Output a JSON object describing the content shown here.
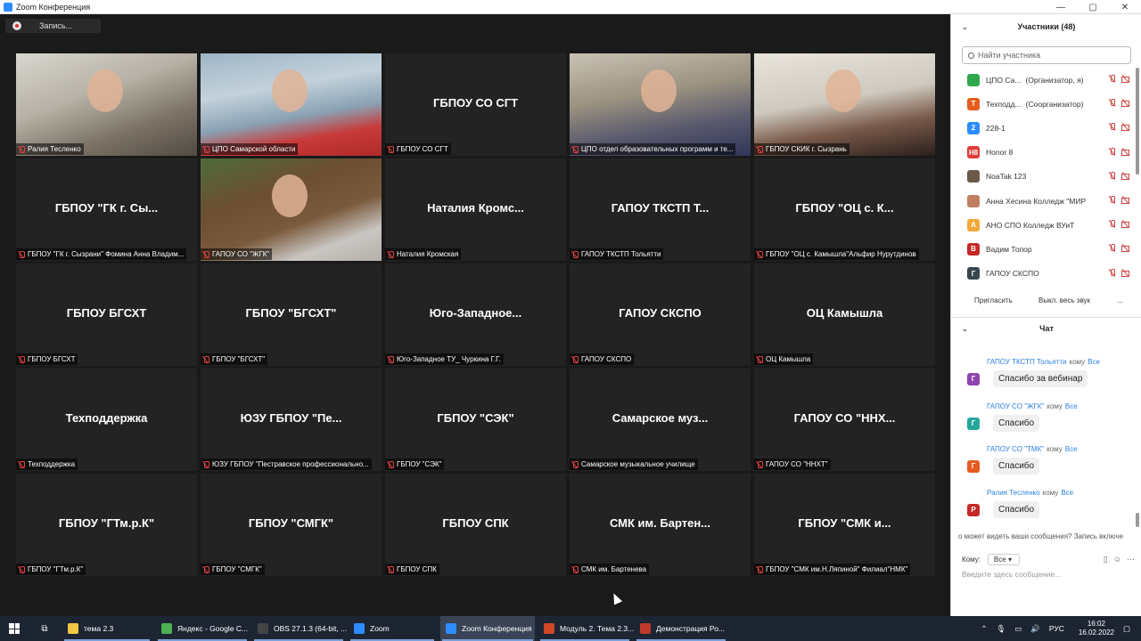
{
  "window": {
    "title": "Zoom Конференция"
  },
  "recording": {
    "label": "Запись..."
  },
  "tiles": [
    {
      "caption": "Ралия Тесленко",
      "center": "",
      "video": "v1"
    },
    {
      "caption": "ЦПО Самарской области",
      "center": "",
      "video": "v2",
      "active": true
    },
    {
      "caption": "ГБПОУ СО СГТ",
      "center": "ГБПОУ СО СГТ"
    },
    {
      "caption": "ЦПО отдел образовательных программ и те...",
      "center": "",
      "video": "v4"
    },
    {
      "caption": "ГБПОУ СКИК г. Сызрань",
      "center": "",
      "video": "v5"
    },
    {
      "caption": "ГБПОУ \"ГК г. Сызрани\" Фомина Анна Владим...",
      "center": "ГБПОУ \"ГК г. Сы..."
    },
    {
      "caption": "ГАПОУ СО \"ЖГК\"",
      "center": "",
      "video": "v7"
    },
    {
      "caption": "Наталия Кромская",
      "center": "Наталия Кромс..."
    },
    {
      "caption": "ГАПОУ ТКСТП Тольятти",
      "center": "ГАПОУ ТКСТП Т..."
    },
    {
      "caption": "ГБПОУ \"ОЦ с. Камышла\"Альфир Нурутдинов",
      "center": "ГБПОУ \"ОЦ с. К..."
    },
    {
      "caption": "ГБПОУ БГСХТ",
      "center": "ГБПОУ БГСХТ"
    },
    {
      "caption": "ГБПОУ \"БГСХТ\"",
      "center": "ГБПОУ \"БГСХТ\""
    },
    {
      "caption": "Юго-Западное ТУ_ Чуркина Г.Г.",
      "center": "Юго-Западное..."
    },
    {
      "caption": "ГАПОУ СКСПО",
      "center": "ГАПОУ СКСПО"
    },
    {
      "caption": "ОЦ Камышла",
      "center": "ОЦ Камышла"
    },
    {
      "caption": "Техподдержка",
      "center": "Техподдержка"
    },
    {
      "caption": "ЮЗУ ГБПОУ \"Пестравское профессионально...",
      "center": "ЮЗУ ГБПОУ \"Пе..."
    },
    {
      "caption": "ГБПОУ \"СЭК\"",
      "center": "ГБПОУ \"СЭК\""
    },
    {
      "caption": "Самарское музыкальное училище",
      "center": "Самарское муз..."
    },
    {
      "caption": "ГАПОУ СО \"ННХТ\"",
      "center": "ГАПОУ СО \"ННХ..."
    },
    {
      "caption": "ГБПОУ \"ГТм.р.К\"",
      "center": "ГБПОУ \"ГТм.р.К\""
    },
    {
      "caption": "ГБПОУ \"СМГК\"",
      "center": "ГБПОУ \"СМГК\""
    },
    {
      "caption": "ГБПОУ СПК",
      "center": "ГБПОУ СПК"
    },
    {
      "caption": "СМК им. Бартенева",
      "center": "СМК им. Бартен..."
    },
    {
      "caption": "ГБПОУ \"СМК им.Н.Ляпиной\" Филиал\"НМК\"",
      "center": "ГБПОУ \"СМК и..."
    }
  ],
  "participants": {
    "title": "Участники (48)",
    "search_placeholder": "Найти участника",
    "items": [
      {
        "initial": "",
        "color": "#2fa84f",
        "name": "ЦПО Са...",
        "role": "(Организатор, я)"
      },
      {
        "initial": "T",
        "color": "#e65c1e",
        "name": "Техподд...",
        "role": "(Соорганизатор)"
      },
      {
        "initial": "2",
        "color": "#2d8cff",
        "name": "228-1",
        "role": ""
      },
      {
        "initial": "H8",
        "color": "#e03a3a",
        "name": "Honor 8",
        "role": ""
      },
      {
        "initial": "",
        "color": "#6b5a4a",
        "name": "NoaTak 123",
        "role": ""
      },
      {
        "initial": "",
        "color": "#c08060",
        "name": "Анна Хесина Колледж \"МИР\"...",
        "role": ""
      },
      {
        "initial": "А",
        "color": "#f2a93b",
        "name": "АНО СПО Колледж ВУиТ",
        "role": ""
      },
      {
        "initial": "В",
        "color": "#c62828",
        "name": "Вадим Топор",
        "role": ""
      },
      {
        "initial": "Г",
        "color": "#37474f",
        "name": "ГАПОУ СКСПО",
        "role": ""
      }
    ],
    "invite_label": "Пригласить",
    "mute_all_label": "Выкл. весь звук",
    "more_label": "..."
  },
  "chat": {
    "title": "Чат",
    "messages": [
      {
        "initial": "Г",
        "color": "#8e44ad",
        "from": "ГАПОУ ТКСТП Тольятти",
        "to_label": "кому",
        "to": "Все",
        "text": "Спасибо за вебинар"
      },
      {
        "initial": "Г",
        "color": "#26a69a",
        "from": "ГАПОУ СО \"ЖГК\"",
        "to_label": "кому",
        "to": "Все",
        "text": "Спасибо"
      },
      {
        "initial": "Г",
        "color": "#e65c1e",
        "from": "ГАПОУ СО \"ТМК\"",
        "to_label": "кому",
        "to": "Все",
        "text": "Спасибо"
      },
      {
        "initial": "Р",
        "color": "#c62828",
        "from": "Ралия Тесленко",
        "to_label": "кому",
        "to": "Все",
        "text": "Спасибо"
      }
    ],
    "notice": "о может видеть ваши сообщения? Запись включе",
    "to_row_label": "Кому:",
    "to_value": "Все",
    "input_placeholder": "Введите здесь сообщение..."
  },
  "taskbar": {
    "items": [
      {
        "label": "тема 2.3",
        "color": "#f2c744"
      },
      {
        "label": "Яндекс - Google C...",
        "color": "#4caf50"
      },
      {
        "label": "OBS 27.1.3 (64-bit, ...",
        "color": "#444444"
      },
      {
        "label": "Zoom",
        "color": "#2d8cff"
      },
      {
        "label": "Zoom Конференция",
        "color": "#2d8cff",
        "active": true
      },
      {
        "label": "Модуль 2. Тема 2.3...",
        "color": "#d24726"
      },
      {
        "label": "Демонстрация Ро...",
        "color": "#c0392b"
      }
    ],
    "lang": "РУС",
    "time": "16:02",
    "date": "16.02.2022"
  }
}
